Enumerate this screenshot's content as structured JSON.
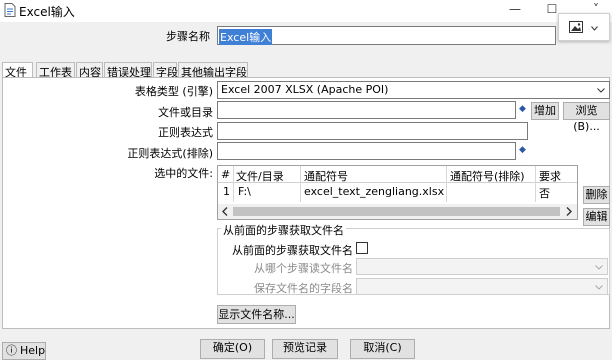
{
  "window": {
    "title": "Excel输入",
    "minimize_icon": "—",
    "maximize_icon": "☐",
    "chevron_icon": "˅"
  },
  "step_name": {
    "label": "步骤名称",
    "value": "Excel输入"
  },
  "tabs": [
    {
      "label": "文件",
      "active": true
    },
    {
      "label": "工作表"
    },
    {
      "label": "内容"
    },
    {
      "label": "错误处理"
    },
    {
      "label": "字段"
    },
    {
      "label": "其他输出字段"
    }
  ],
  "form": {
    "table_type": {
      "label": "表格类型 (引擎)",
      "value": "Excel 2007 XLSX (Apache POI)"
    },
    "file_dir": {
      "label": "文件或目录",
      "value": ""
    },
    "regex": {
      "label": "正则表达式",
      "value": ""
    },
    "regex_exclude": {
      "label": "正则表达式(排除)",
      "value": ""
    },
    "selected_files_label": "选中的文件:",
    "add_button": "增加",
    "browse_button": "浏览(B)...",
    "delete_button": "删除",
    "edit_button": "编辑"
  },
  "files_table": {
    "headers": [
      "#",
      "文件/目录",
      "通配符号",
      "通配符号(排除)",
      "要求"
    ],
    "rows": [
      [
        "1",
        "F:\\",
        "excel_text_zengliang.xlsx",
        "",
        "否"
      ]
    ]
  },
  "previous_step": {
    "group_title": "从前面的步骤获取文件名",
    "checkbox_label": "从前面的步骤获取文件名",
    "step_label": "从哪个步骤读文件名",
    "field_label": "保存文件名的字段名"
  },
  "show_filenames_button": "显示文件名称...",
  "bottom": {
    "help": "Help",
    "ok": "确定(O)",
    "preview": "预览记录",
    "cancel": "取消(C)"
  }
}
